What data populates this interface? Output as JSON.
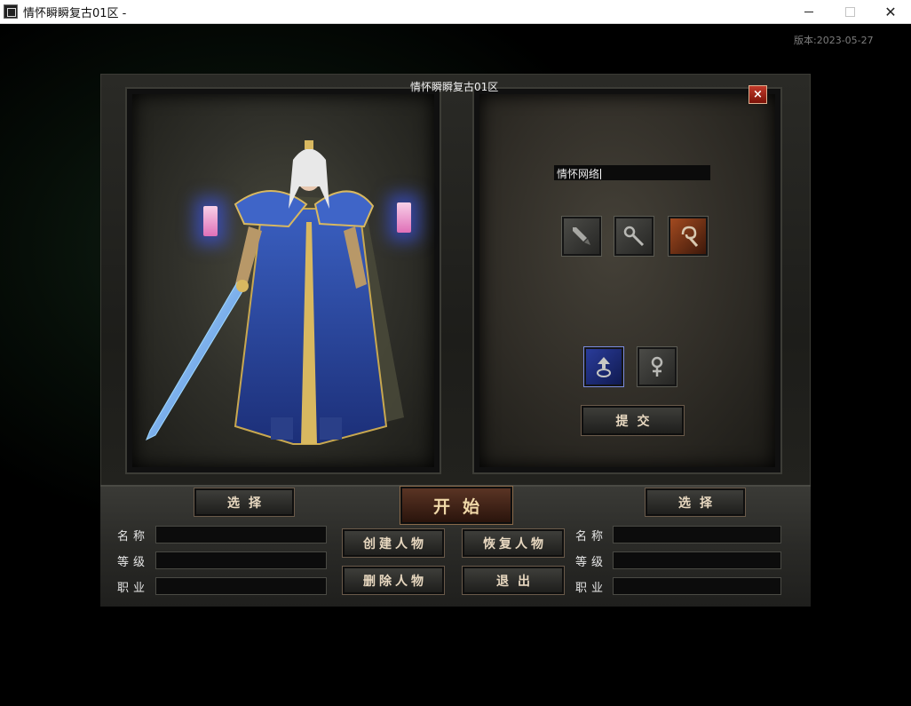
{
  "window": {
    "title": "情怀瞬瞬复古01区 -"
  },
  "version_text": "版本:2023-05-27",
  "dialog": {
    "title": "情怀瞬瞬复古01区",
    "close_label": "×"
  },
  "create_form": {
    "name_value": "情怀网络",
    "jobs": [
      {
        "icon": "sword-icon",
        "glyph": "🗡"
      },
      {
        "icon": "wand-icon",
        "glyph": "✎"
      },
      {
        "icon": "hook-staff-icon",
        "glyph": "ᘎ"
      }
    ],
    "genders": [
      {
        "icon": "male-icon",
        "glyph": "♂"
      },
      {
        "icon": "female-icon",
        "glyph": "♀"
      }
    ],
    "submit_label": "提交"
  },
  "bottom": {
    "start_label": "开始",
    "select_label": "选择",
    "create_label": "创建人物",
    "restore_label": "恢复人物",
    "delete_label": "删除人物",
    "exit_label": "退出",
    "left_slot": {
      "name_label": "名称",
      "level_label": "等级",
      "job_label": "职业",
      "name_value": "",
      "level_value": "",
      "job_value": ""
    },
    "right_slot": {
      "name_label": "名称",
      "level_label": "等级",
      "job_label": "职业",
      "name_value": "",
      "level_value": "",
      "job_value": ""
    }
  },
  "colors": {
    "accent_orange": "#a24a20",
    "accent_blue": "#2a3c9a",
    "close_red": "#c23a2a"
  }
}
